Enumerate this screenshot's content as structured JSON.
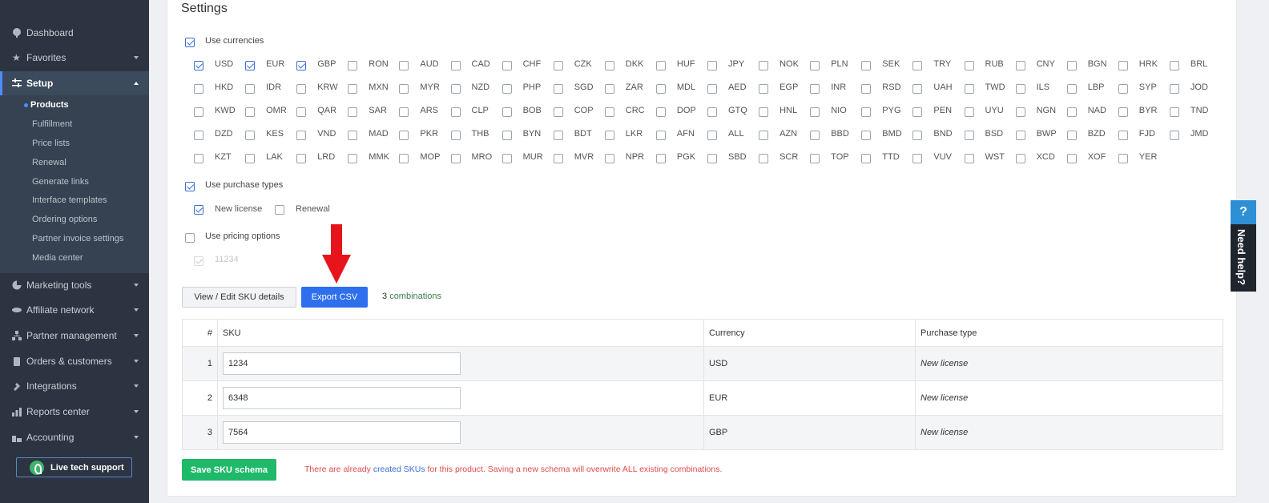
{
  "sidebar": {
    "items": [
      {
        "label": "Dashboard",
        "icon": "dashboard-icon"
      },
      {
        "label": "Favorites",
        "icon": "star-icon"
      },
      {
        "label": "Setup",
        "icon": "sliders-icon"
      },
      {
        "label": "Marketing tools",
        "icon": "pie-chart-icon"
      },
      {
        "label": "Affiliate network",
        "icon": "handshake-icon"
      },
      {
        "label": "Partner management",
        "icon": "hierarchy-icon"
      },
      {
        "label": "Orders & customers",
        "icon": "clipboard-icon"
      },
      {
        "label": "Integrations",
        "icon": "plug-icon"
      },
      {
        "label": "Reports center",
        "icon": "bar-chart-icon"
      },
      {
        "label": "Accounting",
        "icon": "bank-icon"
      }
    ],
    "setup_subitems": [
      "Products",
      "Fulfillment",
      "Price lists",
      "Renewal",
      "Generate links",
      "Interface templates",
      "Ordering options",
      "Partner invoice settings",
      "Media center"
    ],
    "live_support": "Live tech support"
  },
  "settings": {
    "title": "Settings",
    "use_currencies": "Use currencies",
    "use_purchase_types": "Use purchase types",
    "use_pricing_options": "Use pricing options",
    "pricing_option_value": "11234",
    "purchase_types": [
      {
        "label": "New license",
        "checked": true
      },
      {
        "label": "Renewal",
        "checked": false
      }
    ]
  },
  "currencies": [
    [
      "USD",
      "EUR",
      "GBP",
      "RON",
      "AUD",
      "CAD",
      "CHF",
      "CZK",
      "DKK",
      "HUF",
      "JPY",
      "NOK",
      "PLN",
      "SEK",
      "TRY",
      "RUB",
      "CNY",
      "BGN",
      "HRK",
      "BRL"
    ],
    [
      "HKD",
      "IDR",
      "KRW",
      "MXN",
      "MYR",
      "NZD",
      "PHP",
      "SGD",
      "ZAR",
      "MDL",
      "AED",
      "EGP",
      "INR",
      "RSD",
      "UAH",
      "TWD",
      "ILS",
      "LBP",
      "SYP",
      "JOD"
    ],
    [
      "KWD",
      "OMR",
      "QAR",
      "SAR",
      "ARS",
      "CLP",
      "BOB",
      "COP",
      "CRC",
      "DOP",
      "GTQ",
      "HNL",
      "NIO",
      "PYG",
      "PEN",
      "UYU",
      "NGN",
      "NAD",
      "BYR",
      "TND"
    ],
    [
      "DZD",
      "KES",
      "VND",
      "MAD",
      "PKR",
      "THB",
      "BYN",
      "BDT",
      "LKR",
      "AFN",
      "ALL",
      "AZN",
      "BBD",
      "BMD",
      "BND",
      "BSD",
      "BWP",
      "BZD",
      "FJD",
      "JMD"
    ],
    [
      "KZT",
      "LAK",
      "LRD",
      "MMK",
      "MOP",
      "MRO",
      "MUR",
      "MVR",
      "NPR",
      "PGK",
      "SBD",
      "SCR",
      "TOP",
      "TTD",
      "VUV",
      "WST",
      "XCD",
      "XOF",
      "YER"
    ]
  ],
  "checked_currencies": [
    "USD",
    "EUR",
    "GBP"
  ],
  "actions": {
    "view_edit": "View / Edit SKU details",
    "export": "Export CSV",
    "combinations_count": "3",
    "combinations_label": "combinations"
  },
  "table": {
    "headers": {
      "index": "#",
      "sku": "SKU",
      "currency": "Currency",
      "purchase_type": "Purchase type"
    },
    "rows": [
      {
        "index": "1",
        "sku": "1234",
        "currency": "USD",
        "purchase_type": "New license"
      },
      {
        "index": "2",
        "sku": "6348",
        "currency": "EUR",
        "purchase_type": "New license"
      },
      {
        "index": "3",
        "sku": "7564",
        "currency": "GBP",
        "purchase_type": "New license"
      }
    ]
  },
  "footer": {
    "save_button": "Save SKU schema",
    "warning_prefix": "There are already",
    "warning_link": "created SKUs",
    "warning_suffix": "for this product. Saving a new schema will overwrite ALL existing combinations."
  },
  "help": {
    "q": "?",
    "label": "Need help?"
  },
  "colors": {
    "accent": "#2f6fed",
    "save": "#1fb96a",
    "warning": "#e04b4b",
    "sidebar": "#2b3440",
    "arrow": "#e8141b"
  }
}
